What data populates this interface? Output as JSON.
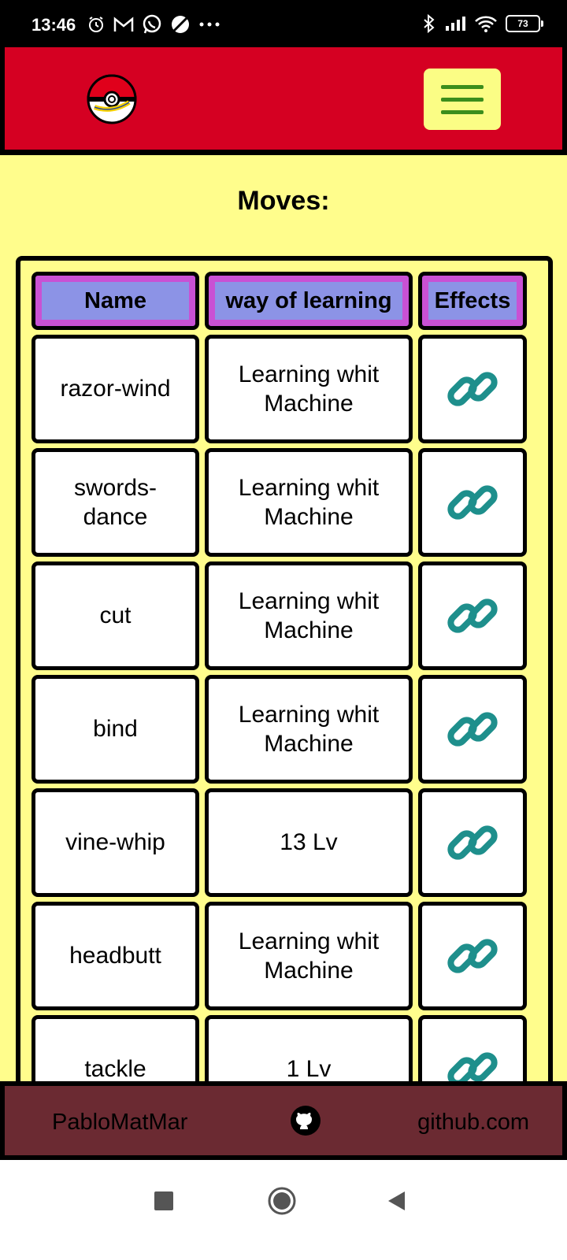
{
  "status": {
    "time": "13:46",
    "battery": "73",
    "left_icons": [
      "alarm-icon",
      "gmail-icon",
      "whatsapp-icon",
      "app-icon",
      "more-icon"
    ],
    "right_icons": [
      "bluetooth-icon",
      "signal-icon",
      "wifi-icon",
      "battery-icon"
    ]
  },
  "header": {
    "logo_alt": "Pokemon"
  },
  "section": {
    "title": "Moves:"
  },
  "table": {
    "headers": {
      "name": "Name",
      "way": "way of learning",
      "effects": "Effects"
    },
    "rows": [
      {
        "name": "razor-wind",
        "way": "Learning whit Machine"
      },
      {
        "name": "swords-dance",
        "way": "Learning whit Machine"
      },
      {
        "name": "cut",
        "way": "Learning whit Machine"
      },
      {
        "name": "bind",
        "way": "Learning whit Machine"
      },
      {
        "name": "vine-whip",
        "way": "13 Lv"
      },
      {
        "name": "headbutt",
        "way": "Learning whit Machine"
      },
      {
        "name": "tackle",
        "way": "1 Lv"
      }
    ]
  },
  "footer": {
    "author": "PabloMatMar",
    "site": "github.com"
  },
  "colors": {
    "header_bg": "#d50022",
    "page_bg": "#fffd8c",
    "footer_bg": "#6b2a32",
    "menu_bg": "#fbfd85",
    "menu_lines": "#3b8e1c",
    "th_outer": "#c951d4",
    "th_inner": "#8c93e6",
    "link_icon": "#1e8f8c"
  }
}
